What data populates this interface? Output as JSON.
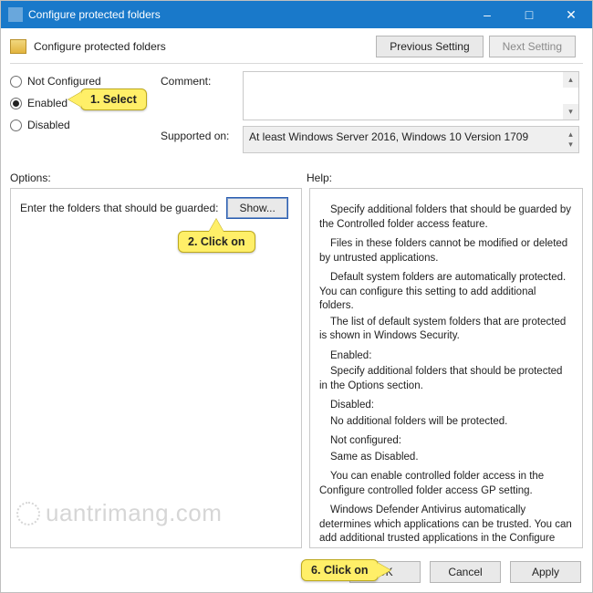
{
  "titlebar": {
    "title": "Configure protected folders"
  },
  "header": {
    "title": "Configure protected folders",
    "previous": "Previous Setting",
    "next": "Next Setting"
  },
  "radios": {
    "not_configured": "Not Configured",
    "enabled": "Enabled",
    "disabled": "Disabled",
    "selected": "enabled"
  },
  "fields": {
    "comment_label": "Comment:",
    "supported_label": "Supported on:",
    "supported_value": "At least Windows Server 2016, Windows 10 Version 1709"
  },
  "mid": {
    "options_label": "Options:",
    "help_label": "Help:"
  },
  "options": {
    "enter_label": "Enter the folders that should be guarded:",
    "show_button": "Show..."
  },
  "help": {
    "p1": "Specify additional folders that should be guarded by the Controlled folder access feature.",
    "p2": "Files in these folders cannot be modified or deleted by untrusted applications.",
    "p3": "Default system folders are automatically protected. You can configure this setting to add additional folders.",
    "p3b": "The list of default system folders that are protected is shown in Windows Security.",
    "p4h": "Enabled:",
    "p4": "Specify additional folders that should be protected in the Options section.",
    "p5h": "Disabled:",
    "p5": "No additional folders will be protected.",
    "p6h": "Not configured:",
    "p6": "Same as Disabled.",
    "p7": "You can enable controlled folder access in the Configure controlled folder access GP setting.",
    "p8": "Windows Defender Antivirus automatically determines which applications can be trusted. You can add additional trusted applications in the Configure allowed applications GP setting."
  },
  "buttons": {
    "ok": "OK",
    "cancel": "Cancel",
    "apply": "Apply"
  },
  "callouts": {
    "c1": "1. Select",
    "c2": "2. Click on",
    "c6": "6. Click on"
  },
  "watermark": "uantrimang.com"
}
